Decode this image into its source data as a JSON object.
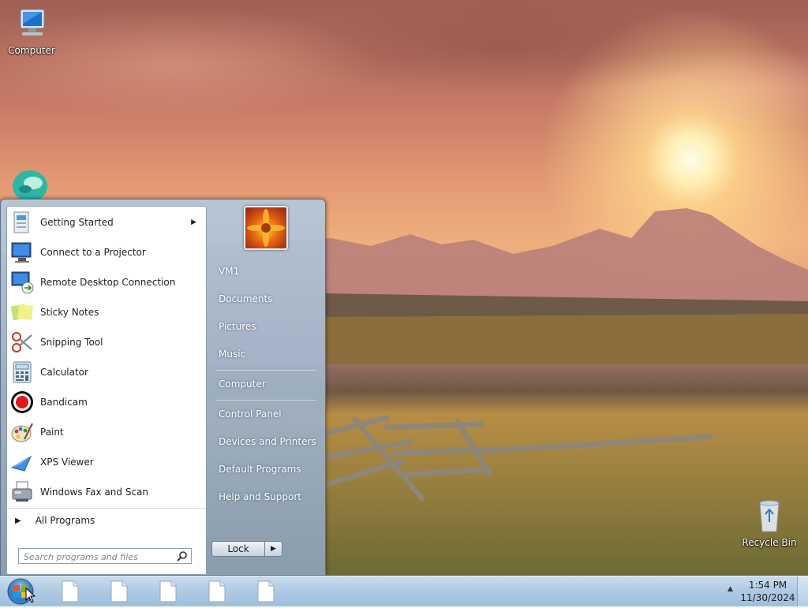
{
  "desktop": {
    "icons": [
      {
        "name": "computer-desktop-icon",
        "label": "Computer"
      },
      {
        "name": "recycle-bin-desktop-icon",
        "label": "Recycle Bin"
      }
    ]
  },
  "start_menu": {
    "programs": [
      {
        "label": "Getting Started",
        "icon": "getting-started-icon",
        "submenu": true
      },
      {
        "label": "Connect to a Projector",
        "icon": "projector-icon",
        "submenu": false
      },
      {
        "label": "Remote Desktop Connection",
        "icon": "remote-desktop-icon",
        "submenu": false
      },
      {
        "label": "Sticky Notes",
        "icon": "sticky-notes-icon",
        "submenu": false
      },
      {
        "label": "Snipping Tool",
        "icon": "scissors-icon",
        "submenu": false
      },
      {
        "label": "Calculator",
        "icon": "calculator-icon",
        "submenu": false
      },
      {
        "label": "Bandicam",
        "icon": "bandicam-icon",
        "submenu": false
      },
      {
        "label": "Paint",
        "icon": "paint-palette-icon",
        "submenu": false
      },
      {
        "label": "XPS Viewer",
        "icon": "xps-viewer-icon",
        "submenu": false
      },
      {
        "label": "Windows Fax and Scan",
        "icon": "fax-icon",
        "submenu": false
      }
    ],
    "all_programs": "All Programs",
    "search_placeholder": "Search programs and files",
    "places": [
      {
        "label": "VM1"
      },
      {
        "label": "Documents"
      },
      {
        "label": "Pictures"
      },
      {
        "label": "Music"
      },
      {
        "label": "Computer"
      },
      {
        "label": "Control Panel"
      },
      {
        "label": "Devices and Printers"
      },
      {
        "label": "Default Programs"
      },
      {
        "label": "Help and Support"
      }
    ],
    "power_button_label": "Lock"
  },
  "taskbar": {
    "pinned_document_count_icons": [
      "document-icon",
      "document-icon",
      "document-icon",
      "document-icon",
      "document-icon"
    ],
    "clock_time": "1:54 PM",
    "clock_date": "11/30/2024"
  },
  "colors": {
    "taskbar": "#aecae4",
    "start_menu_right": "#8ea4ba",
    "accent_text": "#ffffff"
  }
}
